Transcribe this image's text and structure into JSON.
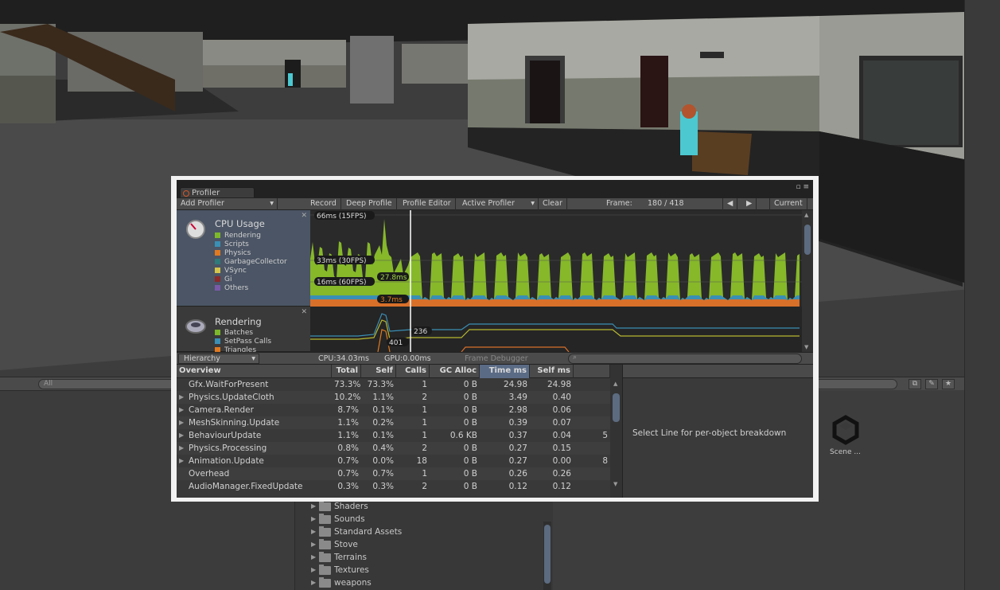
{
  "editor": {
    "search_placeholder": "All",
    "scene_asset_label": "Scene ...",
    "folders": [
      "Shaders",
      "Sounds",
      "Standard Assets",
      "Stove",
      "Terrains",
      "Textures",
      "weapons"
    ]
  },
  "profiler": {
    "tab_title": "Profiler",
    "toolbar": {
      "add_profiler": "Add Profiler",
      "record": "Record",
      "deep_profile": "Deep Profile",
      "profile_editor": "Profile Editor",
      "active_profiler": "Active Profiler",
      "clear": "Clear",
      "frame_label": "Frame:",
      "frame_value": "180 / 418",
      "current": "Current"
    },
    "cpu_panel": {
      "title": "CPU Usage",
      "legend": [
        {
          "label": "Rendering",
          "color": "#7cb82a"
        },
        {
          "label": "Scripts",
          "color": "#3a8fb5"
        },
        {
          "label": "Physics",
          "color": "#e07a20"
        },
        {
          "label": "GarbageCollector",
          "color": "#2f7a7a"
        },
        {
          "label": "VSync",
          "color": "#d4c44a"
        },
        {
          "label": "Gi",
          "color": "#8a2a2a"
        },
        {
          "label": "Others",
          "color": "#7a5aa8"
        }
      ],
      "ref_lines": [
        "66ms (15FPS)",
        "33ms (30FPS)",
        "16ms (60FPS)"
      ],
      "cursor_labels": [
        "27.8ms",
        "3.7ms"
      ]
    },
    "render_panel": {
      "title": "Rendering",
      "legend": [
        {
          "label": "Batches",
          "color": "#7cb82a"
        },
        {
          "label": "SetPass Calls",
          "color": "#3a8fb5"
        },
        {
          "label": "Triangles",
          "color": "#e07a20"
        }
      ],
      "cursor_labels": [
        "236",
        "401"
      ]
    },
    "status": {
      "view_mode": "Hierarchy",
      "cpu": "CPU:34.03ms",
      "gpu": "GPU:0.00ms",
      "frame_debugger": "Frame Debugger"
    },
    "table": {
      "columns": [
        "Overview",
        "Total",
        "Self",
        "Calls",
        "GC Alloc",
        "Time ms",
        "Self ms"
      ],
      "rows": [
        {
          "name": "Gfx.WaitForPresent",
          "expand": false,
          "total": "73.3%",
          "self": "73.3%",
          "calls": "1",
          "gc": "0 B",
          "time": "24.98",
          "selfms": "24.98",
          "extra": ""
        },
        {
          "name": "Physics.UpdateCloth",
          "expand": true,
          "total": "10.2%",
          "self": "1.1%",
          "calls": "2",
          "gc": "0 B",
          "time": "3.49",
          "selfms": "0.40",
          "extra": ""
        },
        {
          "name": "Camera.Render",
          "expand": true,
          "total": "8.7%",
          "self": "0.1%",
          "calls": "1",
          "gc": "0 B",
          "time": "2.98",
          "selfms": "0.06",
          "extra": ""
        },
        {
          "name": "MeshSkinning.Update",
          "expand": true,
          "total": "1.1%",
          "self": "0.2%",
          "calls": "1",
          "gc": "0 B",
          "time": "0.39",
          "selfms": "0.07",
          "extra": ""
        },
        {
          "name": "BehaviourUpdate",
          "expand": true,
          "total": "1.1%",
          "self": "0.1%",
          "calls": "1",
          "gc": "0.6 KB",
          "time": "0.37",
          "selfms": "0.04",
          "extra": "5"
        },
        {
          "name": "Physics.Processing",
          "expand": true,
          "total": "0.8%",
          "self": "0.4%",
          "calls": "2",
          "gc": "0 B",
          "time": "0.27",
          "selfms": "0.15",
          "extra": ""
        },
        {
          "name": "Animation.Update",
          "expand": true,
          "total": "0.7%",
          "self": "0.0%",
          "calls": "18",
          "gc": "0 B",
          "time": "0.27",
          "selfms": "0.00",
          "extra": "8"
        },
        {
          "name": "Overhead",
          "expand": false,
          "total": "0.7%",
          "self": "0.7%",
          "calls": "1",
          "gc": "0 B",
          "time": "0.26",
          "selfms": "0.26",
          "extra": ""
        },
        {
          "name": "AudioManager.FixedUpdate",
          "expand": false,
          "total": "0.3%",
          "self": "0.3%",
          "calls": "2",
          "gc": "0 B",
          "time": "0.12",
          "selfms": "0.12",
          "extra": ""
        }
      ]
    },
    "detail_message": "Select Line for per-object breakdown"
  }
}
